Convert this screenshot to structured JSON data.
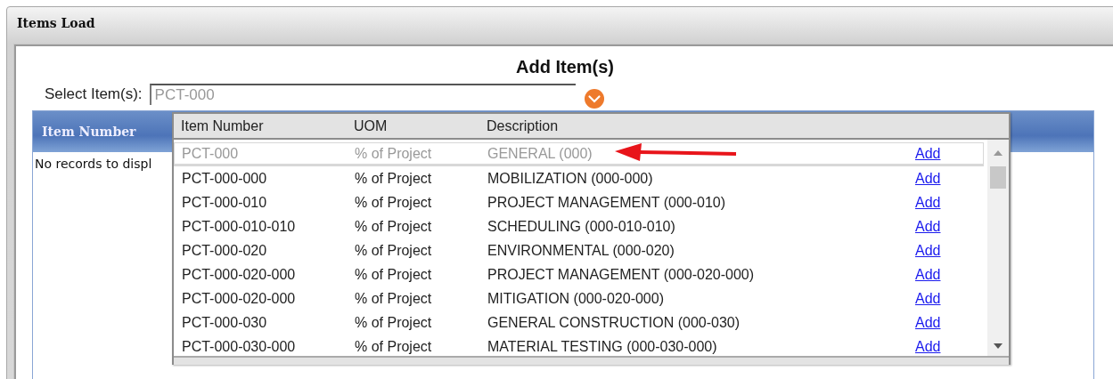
{
  "window": {
    "title": "Items Load"
  },
  "heading": "Add Item(s)",
  "select": {
    "label": "Select Item(s):",
    "value": "PCT-000"
  },
  "grid": {
    "columns": [
      "Item Number"
    ],
    "empty_message": "No records to displ"
  },
  "dropdown": {
    "columns": [
      "Item Number",
      "UOM",
      "Description"
    ],
    "rows": [
      {
        "item_number": "PCT-000",
        "uom": "% of Project",
        "description": "GENERAL (000)",
        "action": "Add",
        "selected": true
      },
      {
        "item_number": "PCT-000-000",
        "uom": "% of Project",
        "description": "MOBILIZATION (000-000)",
        "action": "Add",
        "selected": false
      },
      {
        "item_number": "PCT-000-010",
        "uom": "% of Project",
        "description": "PROJECT MANAGEMENT (000-010)",
        "action": "Add",
        "selected": false
      },
      {
        "item_number": "PCT-000-010-010",
        "uom": "% of Project",
        "description": "SCHEDULING (000-010-010)",
        "action": "Add",
        "selected": false
      },
      {
        "item_number": "PCT-000-020",
        "uom": "% of Project",
        "description": "ENVIRONMENTAL (000-020)",
        "action": "Add",
        "selected": false
      },
      {
        "item_number": "PCT-000-020-000",
        "uom": "% of Project",
        "description": "PROJECT MANAGEMENT (000-020-000)",
        "action": "Add",
        "selected": false
      },
      {
        "item_number": "PCT-000-020-000",
        "uom": "% of Project",
        "description": "MITIGATION (000-020-000)",
        "action": "Add",
        "selected": false
      },
      {
        "item_number": "PCT-000-030",
        "uom": "% of Project",
        "description": "GENERAL CONSTRUCTION (000-030)",
        "action": "Add",
        "selected": false
      },
      {
        "item_number": "PCT-000-030-000",
        "uom": "% of Project",
        "description": "MATERIAL TESTING (000-030-000)",
        "action": "Add",
        "selected": false
      }
    ]
  }
}
